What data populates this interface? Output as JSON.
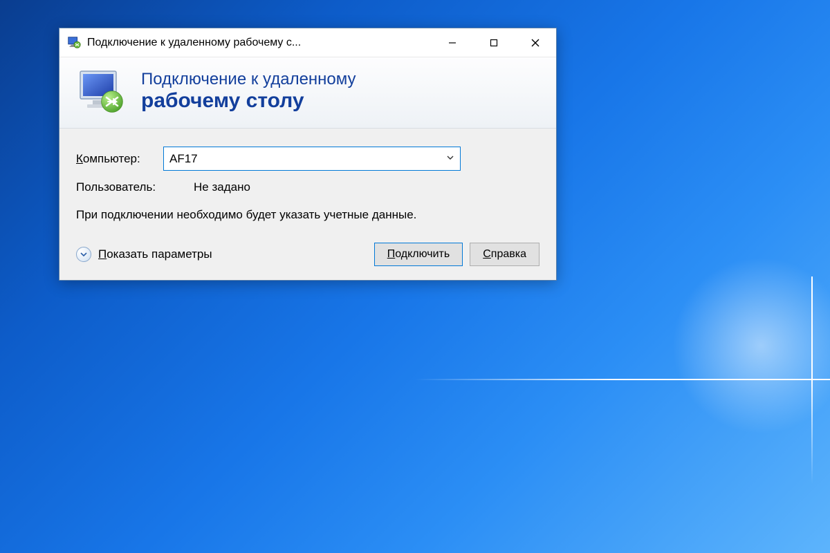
{
  "window": {
    "title": "Подключение к удаленному рабочему с..."
  },
  "banner": {
    "line1": "Подключение к удаленному",
    "line2": "рабочему столу"
  },
  "fields": {
    "computer_label": "Компьютер:",
    "computer_value": "AF17",
    "user_label": "Пользователь:",
    "user_value": "Не задано"
  },
  "info": "При подключении необходимо будет указать учетные данные.",
  "footer": {
    "show_params_label": "Показать параметры",
    "connect_label": "Подключить",
    "help_label": "Справка"
  }
}
